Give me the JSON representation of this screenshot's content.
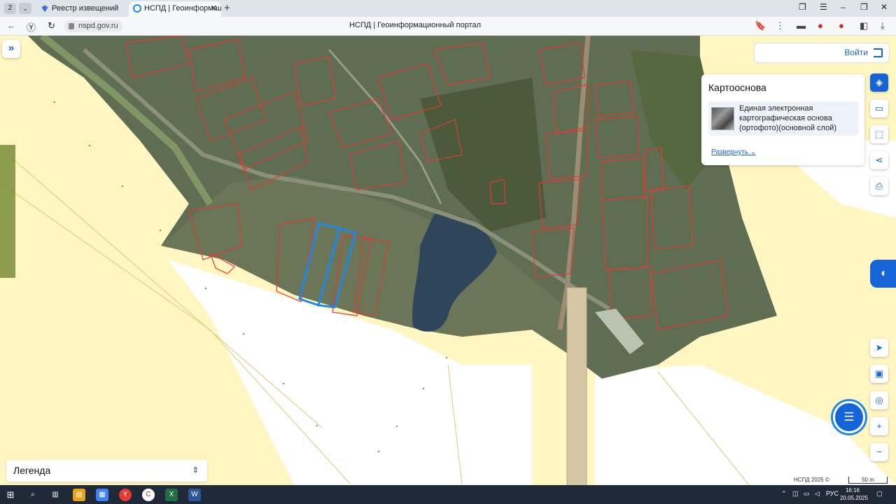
{
  "browser": {
    "tab_count": "2",
    "tabs": [
      {
        "label": "Реестр извещений"
      },
      {
        "label": "НСПД | Геоинформаци"
      }
    ],
    "url": "nspd.gov.ru",
    "page_title": "НСПД | Геоинформационный портал"
  },
  "map": {
    "login_label": "Войти",
    "basemap": {
      "title": "Картооснова",
      "layer_name": "Единая электронная картографическая основа (ортофото)(основной слой)",
      "expand_label": "Развернуть"
    },
    "legend_label": "Легенда",
    "copyright": "НСПД 2025 ©",
    "scale_label": "50 m",
    "colors": {
      "accent": "#1565d8",
      "parcel_outline": "#e53935",
      "selected_parcel": "#1e88e5",
      "land_fill": "#fff6c2"
    }
  },
  "taskbar": {
    "language": "РУС",
    "time": "16:16",
    "date": "20.05.2025"
  }
}
